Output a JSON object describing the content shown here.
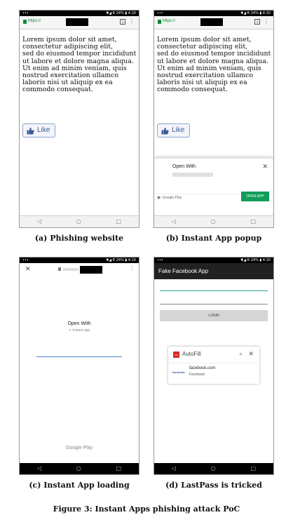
{
  "status_bar": {
    "signal": "•••",
    "right_ab": "▼◢ R 24% ▮ 4:10",
    "right_c": "▼◢ R 24% ▮ 4:10"
  },
  "nav": {
    "back": "◁",
    "home": "○",
    "recents": "□"
  },
  "browser": {
    "url_prefix": "https://",
    "tabs_count": "1",
    "menu": "⋮"
  },
  "lorem_text": "Lorem ipsum dolor sit amet,\nconsectetur adipiscing elit,\nsed do eiusmod tempor incididunt\nut labore et dolore magna aliqua.\nUt enim ad minim veniam, quis\nnostrud exercitation ullamco\nlaboris nisi ut aliquip ex ea\ncommodo consequat.",
  "like_label": "Like",
  "popup": {
    "title": "Open With",
    "close": "✕",
    "play_label": "Google Play",
    "open_app": "OPEN APP"
  },
  "loading": {
    "close": "✕",
    "open_with": "Open With",
    "instant_app": "✦ Instant app",
    "google_play": "Google Play"
  },
  "fake_app": {
    "title": "Fake Facebook App",
    "login": "LOGIN"
  },
  "autofill": {
    "title": "AutoFill",
    "lastpass_mark": "•••",
    "search": "⌕",
    "close": "✕",
    "fb_logo": "facebook",
    "site": "facebook.com",
    "name": "Facebook"
  },
  "captions": {
    "a": "(a) Phishing website",
    "b": "(b) Instant App popup",
    "c": "(c) Instant App loading",
    "d": "(d) LastPass is tricked",
    "figure": "Figure 3: Instant Apps phishing attack PoC"
  }
}
